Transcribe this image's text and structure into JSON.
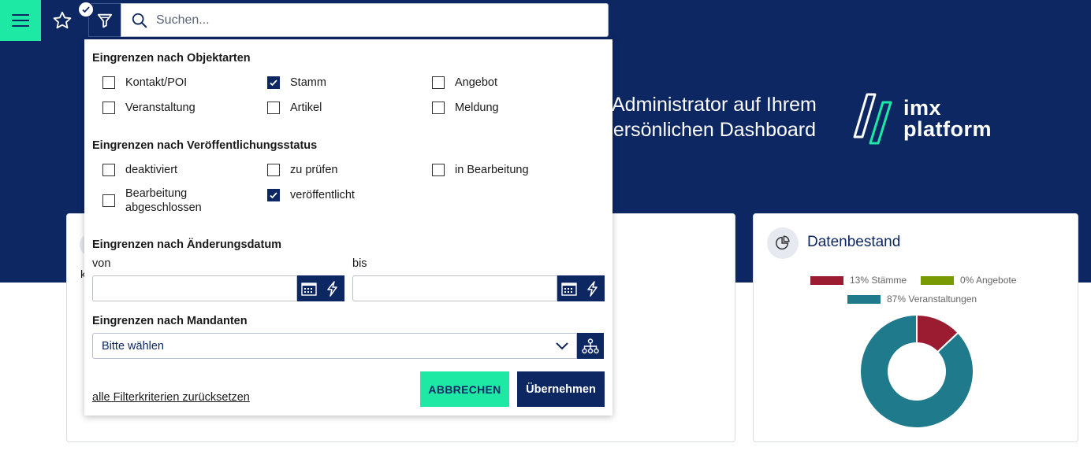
{
  "toolbar": {
    "search_placeholder": "Suchen..."
  },
  "hero": {
    "welcome_line1": "Administrator auf Ihrem",
    "welcome_line2": "persönlichen Dashboard",
    "logo_line1": "imx",
    "logo_line2": "platform"
  },
  "filter": {
    "section_objekt": "Eingrenzen nach Objektarten",
    "objekt_items": [
      {
        "label": "Kontakt/POI",
        "checked": false
      },
      {
        "label": "Stamm",
        "checked": true
      },
      {
        "label": "Angebot",
        "checked": false
      },
      {
        "label": "Veranstaltung",
        "checked": false
      },
      {
        "label": "Artikel",
        "checked": false
      },
      {
        "label": "Meldung",
        "checked": false
      }
    ],
    "section_status": "Eingrenzen nach Veröffentlichungsstatus",
    "status_items": [
      {
        "label": "deaktiviert",
        "checked": false
      },
      {
        "label": "zu prüfen",
        "checked": false
      },
      {
        "label": "in Bearbeitung",
        "checked": false
      },
      {
        "label": "Bearbeitung abgeschlossen",
        "checked": false
      },
      {
        "label": "veröffentlicht",
        "checked": true
      }
    ],
    "section_datum": "Eingrenzen nach Änderungsdatum",
    "von_label": "von",
    "bis_label": "bis",
    "section_mandanten": "Eingrenzen nach Mandanten",
    "mandanten_value": "Bitte wählen",
    "reset_label": "alle Filterkriterien zurücksetzen",
    "cancel_label": "ABBRECHEN",
    "apply_label": "Übernehmen"
  },
  "cards": {
    "left_partial_text": "k",
    "datenbestand_title": "Datenbestand"
  },
  "colors": {
    "navy": "#0d2763",
    "accent": "#1de9a5",
    "stamm": "#9b1b30",
    "angebote": "#7a9a01",
    "veranstaltungen": "#1f7a8c"
  },
  "chart_data": {
    "type": "pie",
    "categories": [
      "Stämme",
      "Angebote",
      "Veranstaltungen"
    ],
    "values": [
      13,
      0,
      87
    ],
    "legend_labels": [
      "13% Stämme",
      "0% Angebote",
      "87% Veranstaltungen"
    ],
    "legend_position": "top",
    "donut": true
  }
}
